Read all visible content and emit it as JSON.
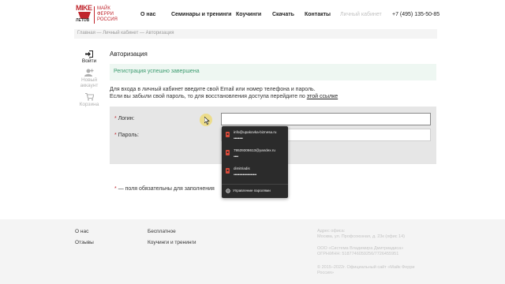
{
  "header": {
    "logo": {
      "mark_text": "MIKE",
      "sub_text": "ЛЕТОВ",
      "lines": [
        "МАЙК",
        "ФЕРРИ",
        "РОССИЯ"
      ]
    },
    "nav": [
      "О нас",
      "Семинары и тренинги",
      "Коучинги",
      "Скачать",
      "Контакты",
      "Личный кабинет"
    ],
    "phone": "+7 (495) 135-50-85"
  },
  "breadcrumb": "Главная — Личный кабинет — Авторизация",
  "sidebar": {
    "items": [
      {
        "label": "Войти",
        "icon": "login-icon"
      },
      {
        "label": "Новый аккаунт",
        "line1": "Новый",
        "line2": "аккаунт",
        "icon": "user-add-icon"
      },
      {
        "label": "Корзина",
        "icon": "cart-icon"
      }
    ]
  },
  "main": {
    "title": "Авторизация",
    "success_message": "Регистрация успешно завершена",
    "intro_line1": "Для входа в личный кабинет введите свой Email или номер телефона и пароль.",
    "intro_line2": "Если вы забыли свой пароль, то для восстановления доступа перейдите по",
    "intro_link": "этой ссылке",
    "login_label": "Логин:",
    "password_label": "Пароль:",
    "login_value": "",
    "password_value": "",
    "required_note": "— поля обязательны для заполнения",
    "required_mark": "*"
  },
  "autofill": {
    "entries": [
      {
        "user": "info@upakovka-biznesa.ru",
        "password": "••••••••"
      },
      {
        "user": "79539306613@yandex.ru",
        "password": "••••"
      },
      {
        "user": "dimitriadis",
        "password": "••••••••••••••••••••"
      }
    ],
    "manage_label": "Управление паролями"
  },
  "footer": {
    "links_col1": [
      "О нас",
      "Отзывы"
    ],
    "links_col2": [
      "Бесплатное",
      "Коучинги и тренинги"
    ],
    "address_label": "Адрес офиса:",
    "address": "Москва, ул. Профсоюзная, д. 23к (офис 14)",
    "company": "ООО «Система Владимира Дмитриадиса»",
    "ogrn": "ОГРН/ИНН: 5187746059256/7726455951",
    "copyright_line1": "© 2015–2022г. Официальный сайт «Майк Ферри",
    "copyright_line2": "Россия»"
  },
  "colors": {
    "brand": "#c0262d",
    "success_text": "#3a9b6e",
    "success_bg": "#eef7f2",
    "panel_bg": "#e6e6e6"
  }
}
